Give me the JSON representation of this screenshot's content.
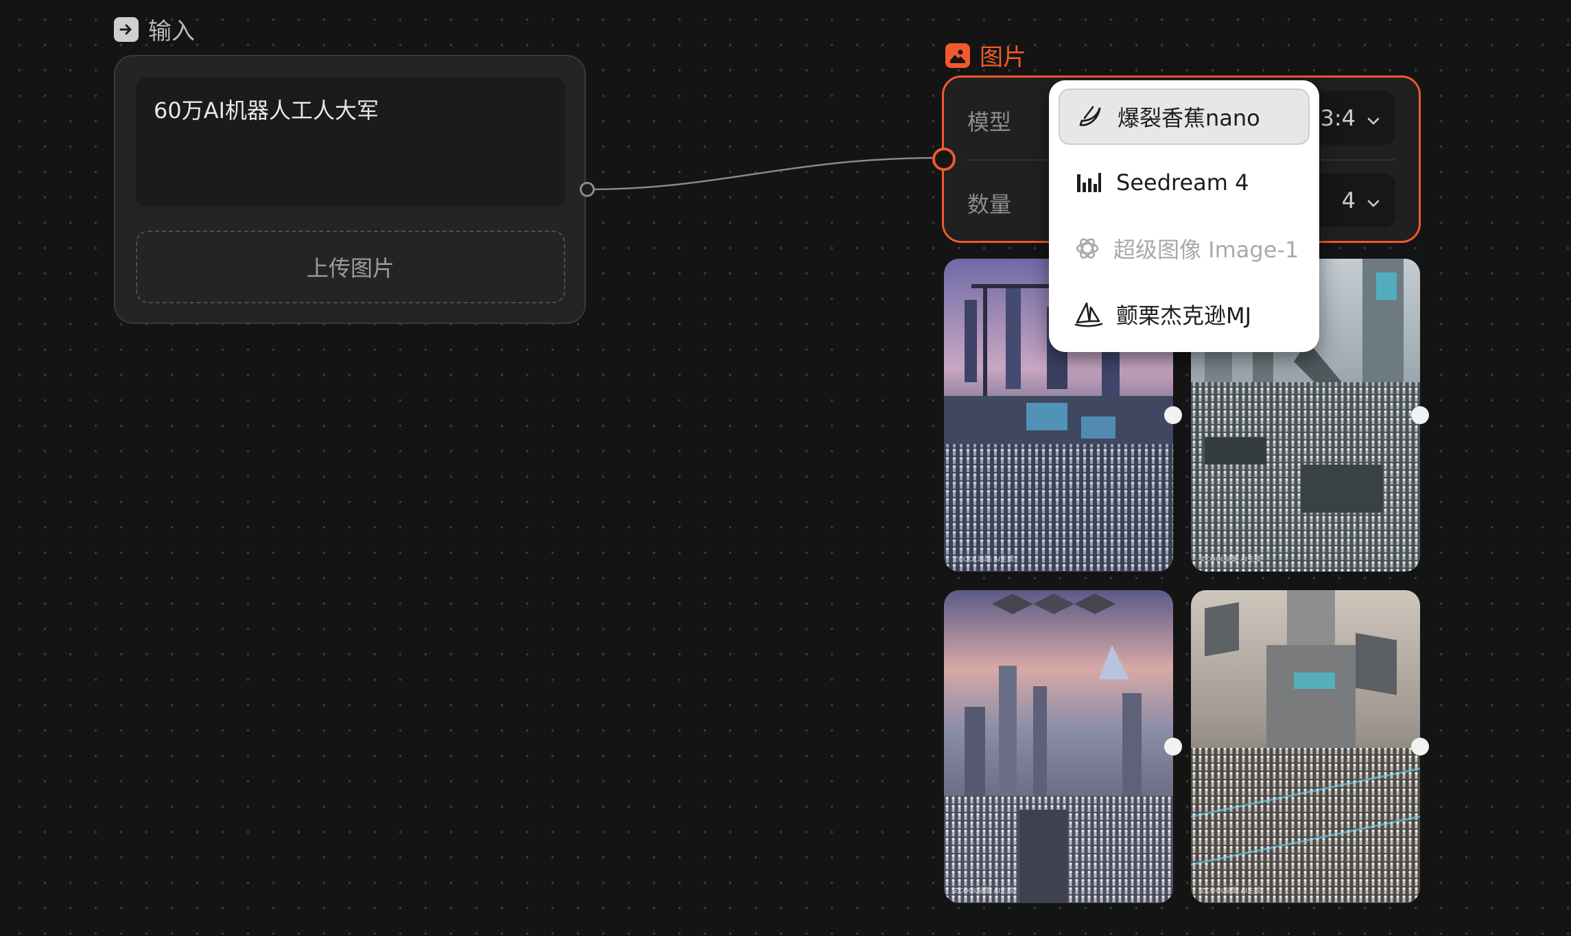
{
  "input_node": {
    "title": "输入",
    "title_icon": "arrow-right-icon",
    "prompt_text": "60万AI机器人工人大军",
    "upload_label": "上传图片"
  },
  "image_node": {
    "title": "图片",
    "title_icon": "image-icon",
    "accent_color": "#f15a2b",
    "model_label": "模型",
    "count_label": "数量",
    "ratio_value": "3:4",
    "count_value": "4"
  },
  "model_dropdown": {
    "items": [
      {
        "label": "爆裂香蕉nano",
        "icon": "banana-icon",
        "selected": true
      },
      {
        "label": "Seedream 4",
        "icon": "seedream-bars-icon",
        "selected": false
      },
      {
        "label": "超级图像 Image-1",
        "icon": "openai-knot-icon",
        "disabled": true
      },
      {
        "label": "颤栗杰克逊MJ",
        "icon": "sailboat-icon",
        "selected": false
      }
    ]
  },
  "generated_images": {
    "watermark": "ZCOOL站酷  AI生成",
    "items": [
      {
        "name": "robot-factory-crane"
      },
      {
        "name": "robot-assembly-plant"
      },
      {
        "name": "robot-city-pyramid"
      },
      {
        "name": "robot-solar-factory"
      }
    ]
  }
}
